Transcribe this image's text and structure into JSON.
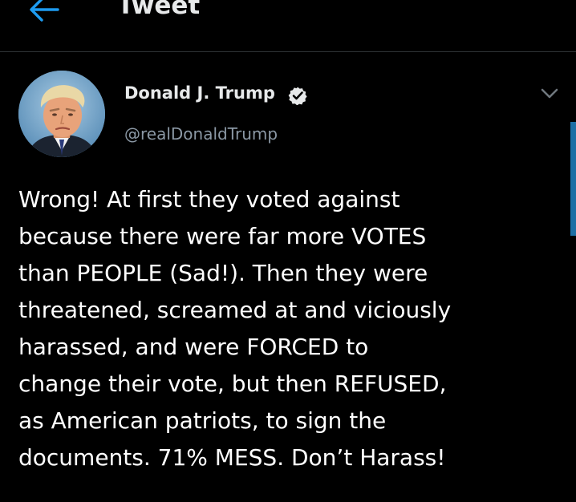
{
  "header": {
    "title": "Tweet"
  },
  "author": {
    "display_name": "Donald J. Trump",
    "handle": "@realDonaldTrump",
    "verified": true
  },
  "tweet": {
    "lines": [
      "Wrong! At first they voted against",
      "because there were far more VOTES",
      "than PEOPLE (Sad!). Then they were",
      "threatened, screamed at and viciously",
      "harassed, and were FORCED to",
      "change their vote, but then REFUSED,",
      "as American patriots, to sign the",
      "documents. 71% MESS. Don’t Harass!"
    ]
  },
  "icons": {
    "back": "arrow-left-icon",
    "verified": "verified-badge-icon",
    "more": "chevron-down-icon"
  },
  "colors": {
    "background": "#000000",
    "accent": "#1d9bf0",
    "text": "#ffffff",
    "secondary_text": "#8b98a5",
    "divider": "#2f3336"
  }
}
